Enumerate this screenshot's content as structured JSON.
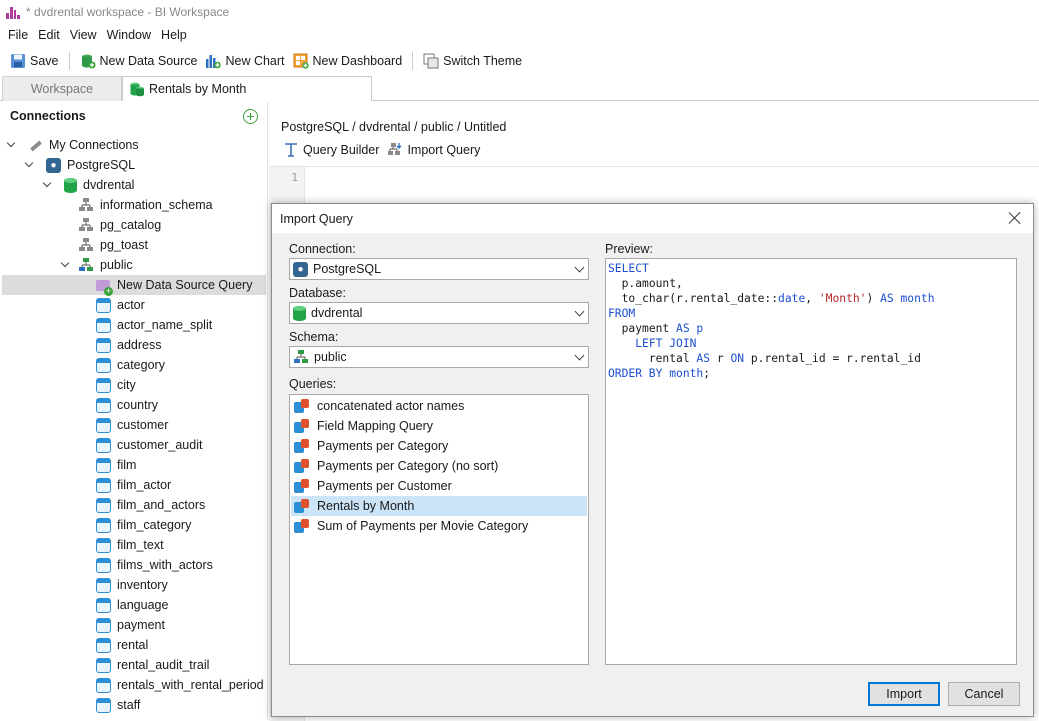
{
  "window": {
    "title": "* dvdrental workspace - BI Workspace"
  },
  "menu": [
    "File",
    "Edit",
    "View",
    "Window",
    "Help"
  ],
  "toolbar": {
    "save": "Save",
    "new_data_source": "New Data Source",
    "new_chart": "New Chart",
    "new_dashboard": "New Dashboard",
    "switch_theme": "Switch Theme"
  },
  "tabs": {
    "workspace": "Workspace",
    "rentals": "Rentals by Month"
  },
  "connections_panel": {
    "title": "Connections",
    "my_connections": "My Connections",
    "postgresql": "PostgreSQL",
    "dvdrental": "dvdrental",
    "schemas": [
      "information_schema",
      "pg_catalog",
      "pg_toast",
      "public"
    ],
    "new_query": "New Data Source Query",
    "tables": [
      "actor",
      "actor_name_split",
      "address",
      "category",
      "city",
      "country",
      "customer",
      "customer_audit",
      "film",
      "film_actor",
      "film_and_actors",
      "film_category",
      "film_text",
      "films_with_actors",
      "inventory",
      "language",
      "payment",
      "rental",
      "rental_audit_trail",
      "rentals_with_rental_period",
      "staff"
    ]
  },
  "editor": {
    "breadcrumb": "PostgreSQL / dvdrental / public / Untitled",
    "query_builder": "Query Builder",
    "import_query": "Import Query",
    "line_number": "1"
  },
  "dialog": {
    "title": "Import Query",
    "connection_label": "Connection:",
    "connection_value": "PostgreSQL",
    "database_label": "Database:",
    "database_value": "dvdrental",
    "schema_label": "Schema:",
    "schema_value": "public",
    "queries_label": "Queries:",
    "queries": [
      "concatenated actor names",
      "Field Mapping Query",
      "Payments per Category",
      "Payments per Category (no sort)",
      "Payments per Customer",
      "Rentals by Month",
      "Sum of Payments per Movie Category"
    ],
    "selected_query": "Rentals by Month",
    "preview_label": "Preview:",
    "sql": {
      "l1_kw": "SELECT",
      "l2": "p.amount,",
      "l3_a": "to_char(r.rental_date::",
      "l3_kw1": "date",
      "l3_b": ", ",
      "l3_str": "'Month'",
      "l3_c": ") ",
      "l3_kw2": "AS month",
      "l4_kw": "FROM",
      "l5_a": "payment ",
      "l5_kw": "AS p",
      "l6_kw": "LEFT JOIN",
      "l7_a": "rental ",
      "l7_kw1": "AS",
      "l7_b": " r ",
      "l7_kw2": "ON",
      "l7_c": " p.rental_id = r.rental_id",
      "l8_kw": "ORDER BY month",
      "l8_end": ";"
    },
    "import_button": "Import",
    "cancel_button": "Cancel"
  }
}
